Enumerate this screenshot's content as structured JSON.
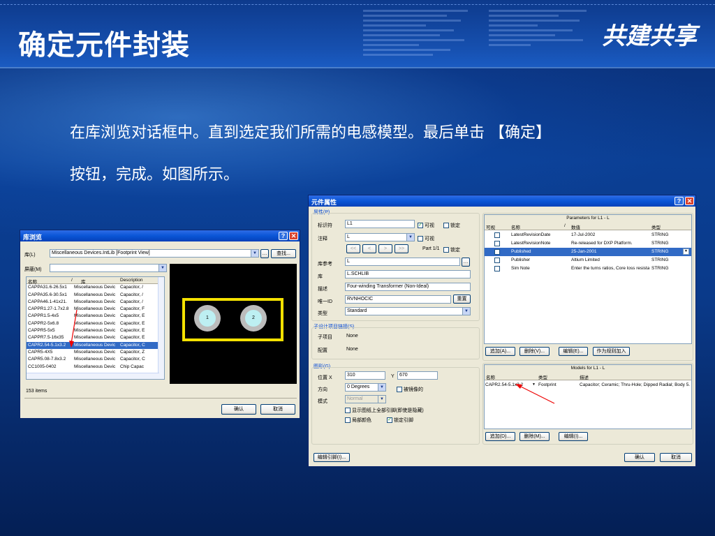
{
  "slide": {
    "title": "确定元件封装",
    "brand": "共建共享",
    "line1": "在库浏览对话框中。直到选定我们所需的电感模型。最后单击 【确定】",
    "line2": "按钮，完成。如图所示。"
  },
  "lib_browser": {
    "title": "库浏览",
    "lib_label": "库(L)",
    "lib_value": "Miscellaneous Devices.IntLib [Footprint View]",
    "find_button": "查找...",
    "mask_label": "屏蔽(M)",
    "mask_value": "",
    "col_name": "名称",
    "col_sort": "/",
    "col_lib": "库",
    "col_desc": "Description",
    "rows": [
      {
        "name": "CAPPA31.6-26.5x1",
        "lib": "Miscellaneous Devic",
        "desc": "Capacitor, /"
      },
      {
        "name": "CAPPA35.6-30.5x1",
        "lib": "Miscellaneous Devic",
        "desc": "Capacitor, /"
      },
      {
        "name": "CAPPA46.1-41x21.",
        "lib": "Miscellaneous Devic",
        "desc": "Capacitor, /"
      },
      {
        "name": "CAPPR1.27-1.7x2.8",
        "lib": "Miscellaneous Devic",
        "desc": "Capacitor, F"
      },
      {
        "name": "CAPPR1.5-4x5",
        "lib": "Miscellaneous Devic",
        "desc": "Capacitor, E"
      },
      {
        "name": "CAPPR2-5x6.8",
        "lib": "Miscellaneous Devic",
        "desc": "Capacitor, E"
      },
      {
        "name": "CAPPR5-5x5",
        "lib": "Miscellaneous Devic",
        "desc": "Capacitor, E"
      },
      {
        "name": "CAPPR7.5-16x35",
        "lib": "Miscellaneous Devic",
        "desc": "Capacitor, E"
      },
      {
        "name": "CAPR2.54-5.1x3.2",
        "lib": "Miscellaneous Devic",
        "desc": "Capacitor, C"
      },
      {
        "name": "CAPR5-4X5",
        "lib": "Miscellaneous Devic",
        "desc": "Capacitor, Z"
      },
      {
        "name": "CAPR5.08-7.8x3.2",
        "lib": "Miscellaneous Devic",
        "desc": "Capacitor, C"
      },
      {
        "name": "CC1005-0402",
        "lib": "Miscellaneous Devic",
        "desc": "Chip Capac"
      }
    ],
    "selected_index": 8,
    "item_count": "153 items",
    "pad1": "1",
    "pad2": "2",
    "ok_button": "确认",
    "cancel_button": "取消"
  },
  "props": {
    "title": "元件属性",
    "attr_group": "属性(P)",
    "designator_label": "标识符",
    "designator_value": "L1",
    "visible1": "可视",
    "locked1": "锁定",
    "comment_label": "注释",
    "comment_value": "L",
    "visible2": "可视",
    "nav_buttons": [
      "<<",
      "<",
      ">",
      ">>"
    ],
    "part_text": "Part 1/1",
    "locked2": "锁定",
    "libref_label": "库参考",
    "libref_value": "L",
    "lib_label": "库",
    "lib_value": "L.SCHLIB",
    "desc_label": "描述",
    "desc_value": "Four-winding Transformer (Non-Ideal)",
    "uid_label": "唯一ID",
    "uid_value": "RVNHOCIC",
    "reset_button": "重置",
    "type_label": "类型",
    "type_value": "Standard",
    "subdesign_group": "子设计项目链接(S)",
    "subproject_label": "子项目",
    "subproject_value": "None",
    "config_label": "配置",
    "config_value": "None",
    "graphic_group": "图形(G)",
    "posx_label": "位置 X",
    "posx_value": "310",
    "posy_label": "Y",
    "posy_value": "670",
    "orient_label": "方向",
    "orient_value": "0 Degrees",
    "mirror_label": "被镜像的",
    "mode_label": "模式",
    "mode_value": "Normal",
    "show_all_pins": "显示图纸上全部引脚(即使是隐藏)",
    "local_colors": "局部颜色",
    "lock_pins": "锁定引脚",
    "params_title": "Parameters for L1 - L",
    "params_cols": [
      "可视",
      "名称",
      "/",
      "数值",
      "类型"
    ],
    "params": [
      {
        "name": "LatestRevisionDate",
        "value": "17-Jul-2002",
        "type": "STRING"
      },
      {
        "name": "LatestRevisionNote",
        "value": "Re-released for DXP Platform.",
        "type": "STRING"
      },
      {
        "name": "Published",
        "value": "25-Jan-2001",
        "type": "STRING"
      },
      {
        "name": "Publisher",
        "value": "Altium Limited",
        "type": "STRING"
      },
      {
        "name": "Sim Note",
        "value": "Enter the turns ratios, Core loss resista",
        "type": "STRING"
      }
    ],
    "params_selected": 2,
    "add_button": "追加(A)...",
    "delete_button": "删除(V)...",
    "edit_button": "编辑(E)...",
    "add_rule_button": "作为规则加入",
    "models_title": "Models for L1 - L",
    "models_cols": [
      "名称",
      "类型",
      "描述"
    ],
    "model_name": "CAPR2.54-5.1x3.2",
    "model_type": "Footprint",
    "model_desc": "Capacitor; Ceramic; Thru-Hole; Dipped Radial; Body 5.",
    "models_add": "追加(D)...",
    "models_delete": "删除(M)...",
    "models_edit": "编辑(I)...",
    "edit_pins": "编辑引脚(I)...",
    "ok_button": "确认",
    "cancel_button": "取消"
  }
}
